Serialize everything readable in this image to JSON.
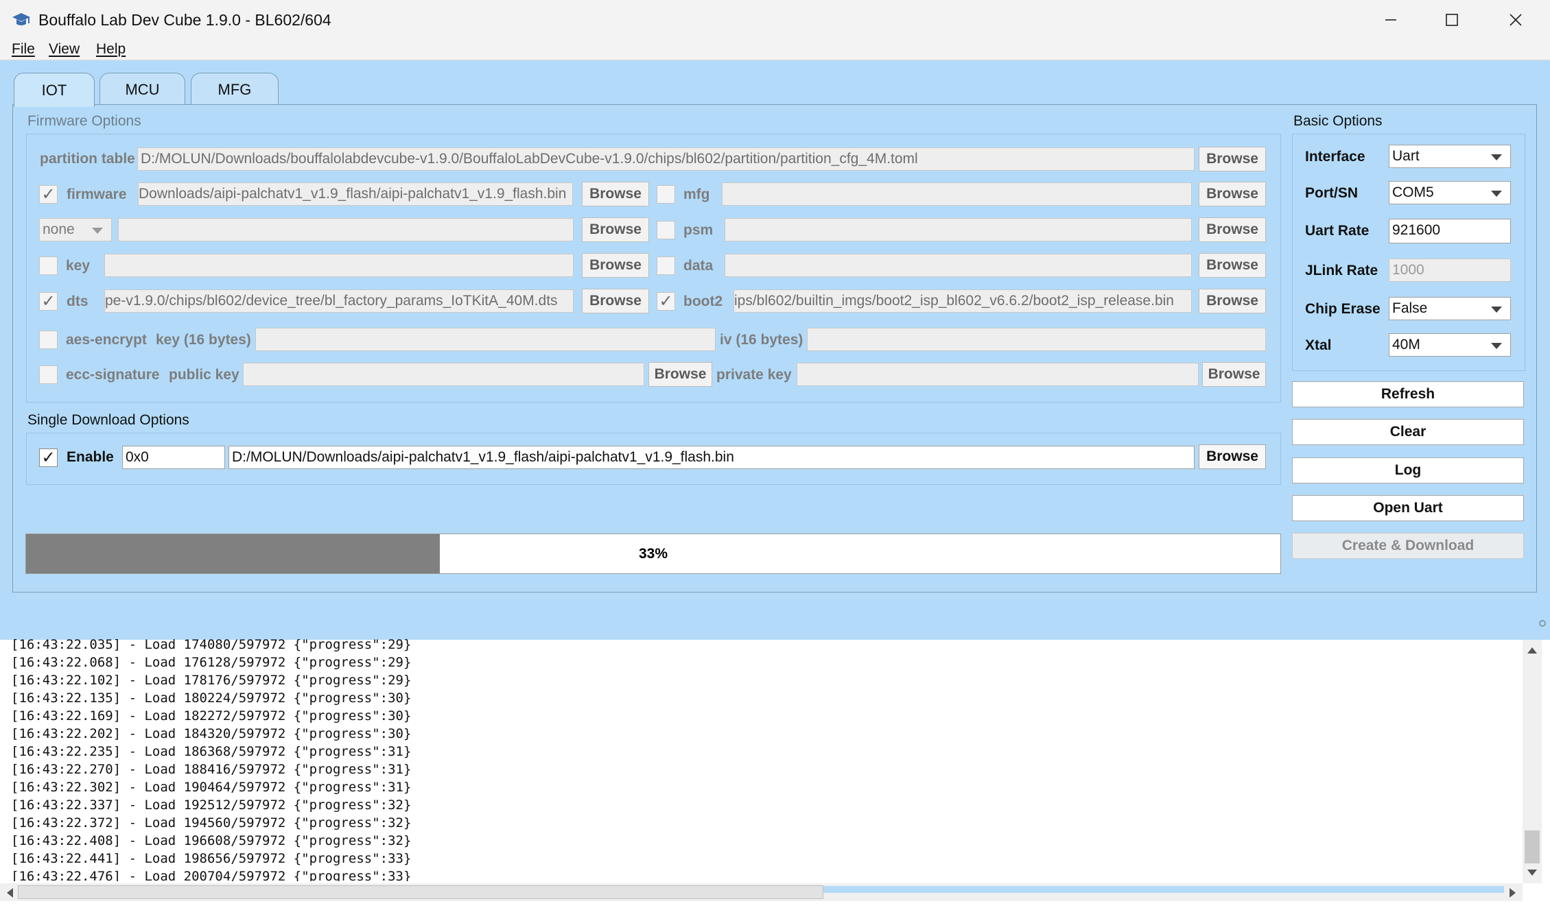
{
  "window": {
    "title": "Bouffalo Lab Dev Cube 1.9.0 - BL602/604"
  },
  "menu": {
    "file": "File",
    "view": "View",
    "help": "Help"
  },
  "tabs": {
    "iot": "IOT",
    "mcu": "MCU",
    "mfg": "MFG"
  },
  "firmware_options": {
    "title": "Firmware Options",
    "browse": "Browse",
    "partition_table": {
      "label": "partition table",
      "value": "D:/MOLUN/Downloads/bouffalolabdevcube-v1.9.0/BouffaloLabDevCube-v1.9.0/chips/bl602/partition/partition_cfg_4M.toml"
    },
    "firmware": {
      "label": "firmware",
      "checked": "✓",
      "value": "Downloads/aipi-palchatv1_v1.9_flash/aipi-palchatv1_v1.9_flash.bin"
    },
    "mfg": {
      "label": "mfg",
      "value": ""
    },
    "none_select": {
      "value": "none",
      "path": ""
    },
    "psm": {
      "label": "psm",
      "value": ""
    },
    "key": {
      "label": "key",
      "value": ""
    },
    "data": {
      "label": "data",
      "value": ""
    },
    "dts": {
      "label": "dts",
      "checked": "✓",
      "value": "pe-v1.9.0/chips/bl602/device_tree/bl_factory_params_IoTKitA_40M.dts"
    },
    "boot2": {
      "label": "boot2",
      "checked": "✓",
      "value": "ips/bl602/builtin_imgs/boot2_isp_bl602_v6.6.2/boot2_isp_release.bin"
    },
    "aes_encrypt": {
      "label": "aes-encrypt",
      "key_label": "key (16 bytes)",
      "key_value": "",
      "iv_label": "iv (16 bytes)",
      "iv_value": ""
    },
    "ecc_signature": {
      "label": "ecc-signature",
      "public_key_label": "public key",
      "public_key_value": "",
      "private_key_label": "private key",
      "private_key_value": ""
    }
  },
  "single_download": {
    "title": "Single Download Options",
    "enable_label": "Enable",
    "checked": "✓",
    "address": "0x0",
    "path": "D:/MOLUN/Downloads/aipi-palchatv1_v1.9_flash/aipi-palchatv1_v1.9_flash.bin",
    "browse": "Browse"
  },
  "progress": {
    "percent": 33,
    "text": "33%"
  },
  "basic_options": {
    "title": "Basic Options",
    "interface_label": "Interface",
    "interface_value": "Uart",
    "port_label": "Port/SN",
    "port_value": "COM5",
    "uart_rate_label": "Uart Rate",
    "uart_rate_value": "921600",
    "jlink_rate_label": "JLink Rate",
    "jlink_rate_value": "1000",
    "chip_erase_label": "Chip Erase",
    "chip_erase_value": "False",
    "xtal_label": "Xtal",
    "xtal_value": "40M"
  },
  "side_buttons": {
    "refresh": "Refresh",
    "clear": "Clear",
    "log": "Log",
    "open_uart": "Open Uart",
    "create_download": "Create & Download"
  },
  "log": {
    "lines": [
      "[16:43:22.035] - Load 174080/597972 {\"progress\":29}",
      "[16:43:22.068] - Load 176128/597972 {\"progress\":29}",
      "[16:43:22.102] - Load 178176/597972 {\"progress\":29}",
      "[16:43:22.135] - Load 180224/597972 {\"progress\":30}",
      "[16:43:22.169] - Load 182272/597972 {\"progress\":30}",
      "[16:43:22.202] - Load 184320/597972 {\"progress\":30}",
      "[16:43:22.235] - Load 186368/597972 {\"progress\":31}",
      "[16:43:22.270] - Load 188416/597972 {\"progress\":31}",
      "[16:43:22.302] - Load 190464/597972 {\"progress\":31}",
      "[16:43:22.337] - Load 192512/597972 {\"progress\":32}",
      "[16:43:22.372] - Load 194560/597972 {\"progress\":32}",
      "[16:43:22.408] - Load 196608/597972 {\"progress\":32}",
      "[16:43:22.441] - Load 198656/597972 {\"progress\":33}",
      "[16:43:22.476] - Load 200704/597972 {\"progress\":33}"
    ]
  }
}
